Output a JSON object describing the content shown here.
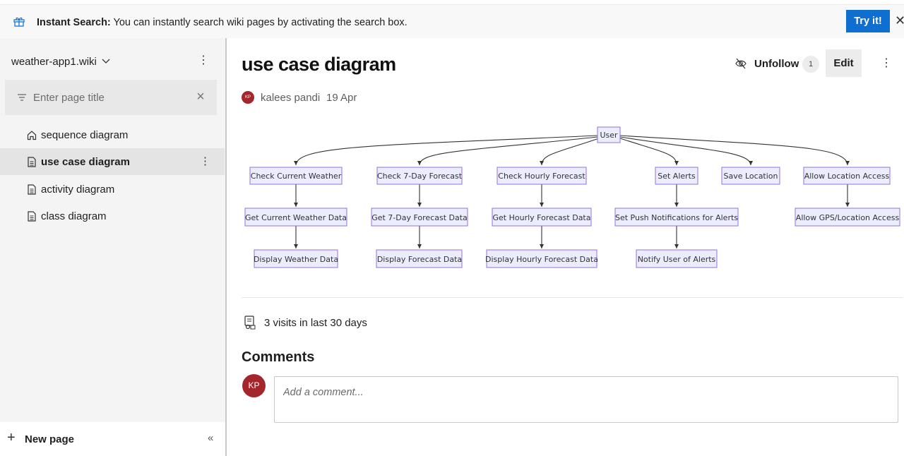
{
  "banner": {
    "title": "Instant Search:",
    "message": " You can instantly search wiki pages by activating the search box.",
    "try_label": "Try it!",
    "close_glyph": "✕"
  },
  "sidebar": {
    "wiki_name": "weather-app1.wiki",
    "filter_placeholder": "Enter page title",
    "items": [
      {
        "label": "sequence diagram",
        "icon": "home-icon",
        "active": false
      },
      {
        "label": "use case diagram",
        "icon": "page-icon",
        "active": true
      },
      {
        "label": "activity diagram",
        "icon": "page-icon",
        "active": false
      },
      {
        "label": "class diagram",
        "icon": "page-icon",
        "active": false
      }
    ],
    "new_page_label": "New page"
  },
  "page": {
    "title": "use case diagram",
    "unfollow_label": "Unfollow",
    "follow_count": "1",
    "edit_label": "Edit",
    "author_initials": "KP",
    "author": "kalees pandi",
    "date": "19 Apr"
  },
  "diagram": {
    "root": "User",
    "level1": [
      "Check Current Weather",
      "Check 7-Day Forecast",
      "Check Hourly Forecast",
      "Set Alerts",
      "Save Location",
      "Allow Location Access"
    ],
    "level2": [
      "Get Current Weather Data",
      "Get 7-Day Forecast Data",
      "Get Hourly Forecast Data",
      "Set Push Notifications for Alerts",
      "Allow GPS/Location Access"
    ],
    "level3": [
      "Display Weather Data",
      "Display Forecast Data",
      "Display Hourly Forecast Data",
      "Notify User of Alerts"
    ],
    "colors": {
      "node_fill": "#ececff",
      "node_border": "#9370db",
      "edge": "#333333"
    }
  },
  "stats": {
    "visits": "3 visits in last 30 days"
  },
  "comments": {
    "title": "Comments",
    "avatar_initials": "KP",
    "placeholder": "Add a comment..."
  },
  "colors": {
    "accent": "#0f6fd1",
    "avatar": "#a4262c"
  }
}
